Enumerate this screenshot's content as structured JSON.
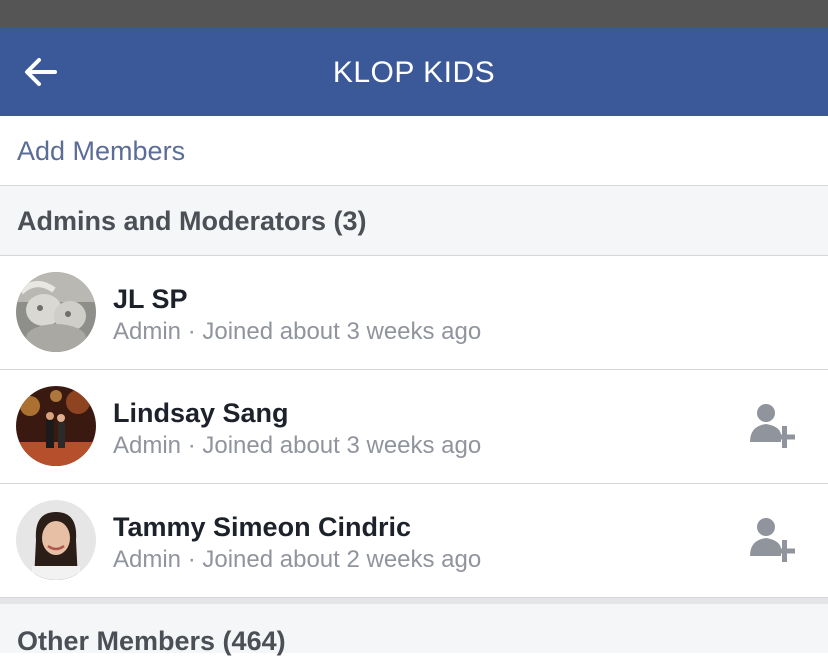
{
  "nav": {
    "title": "KLOP KIDS",
    "back_icon": "arrow-left-icon",
    "color": "#3b5998"
  },
  "add_members": {
    "label": "Add Members",
    "color": "#5b6d97"
  },
  "admins_section": {
    "title": "Admins and Moderators (3)"
  },
  "members": [
    {
      "name": "JL SP",
      "role": "Admin",
      "joined": "Joined about 3 weeks ago",
      "meta": "Admin · Joined about 3 weeks ago",
      "add_friend": false,
      "avatar": "avatar-cherubs-statue"
    },
    {
      "name": "Lindsay Sang",
      "role": "Admin",
      "joined": "Joined about 3 weeks ago",
      "meta": "Admin · Joined about 3 weeks ago",
      "add_friend": true,
      "avatar": "avatar-couple-night"
    },
    {
      "name": "Tammy Simeon Cindric",
      "role": "Admin",
      "joined": "Joined about 2 weeks ago",
      "meta": "Admin · Joined about 2 weeks ago",
      "add_friend": true,
      "avatar": "avatar-woman-portrait"
    }
  ],
  "other_section": {
    "title": "Other Members (464)"
  },
  "icons": {
    "add_friend": "add-friend-icon"
  }
}
